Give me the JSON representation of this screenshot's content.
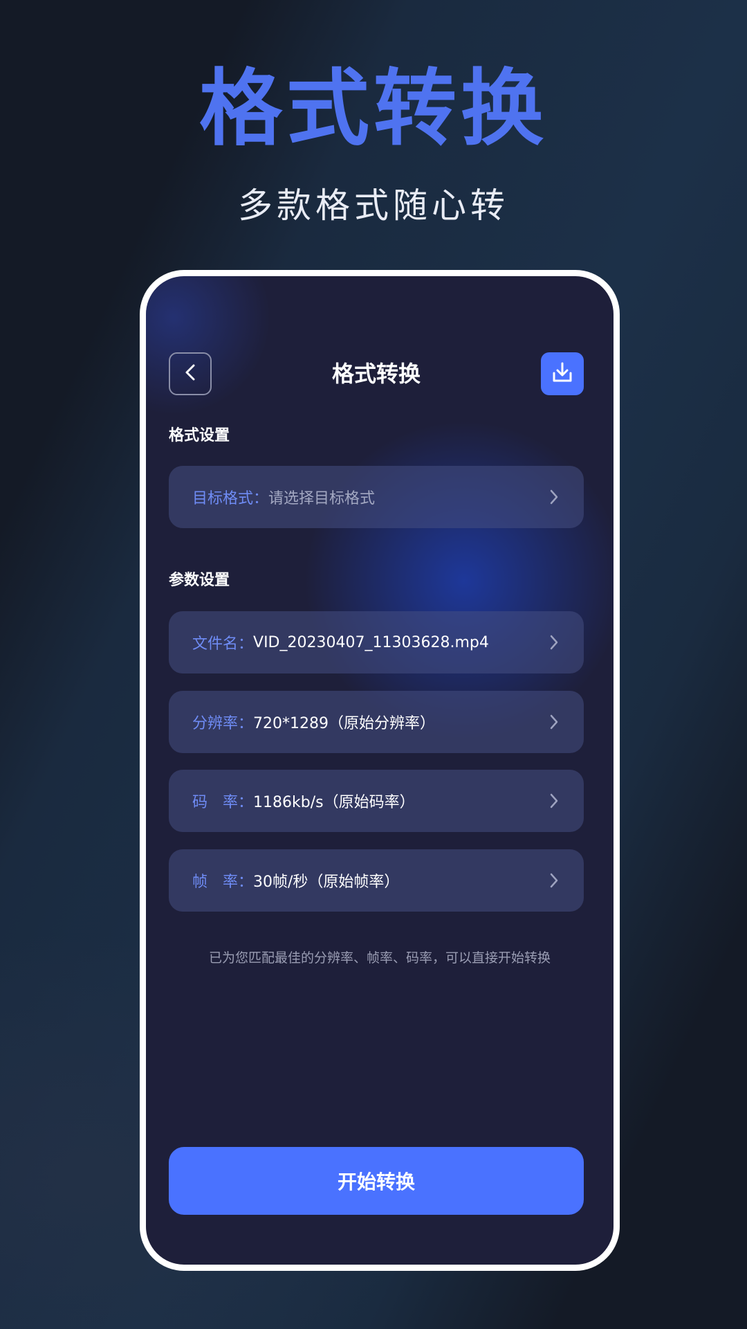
{
  "poster": {
    "title": "格式转换",
    "subtitle": "多款格式随心转"
  },
  "nav": {
    "title": "格式转换",
    "back_icon": "chevron-left-icon",
    "download_icon": "download-icon"
  },
  "format_section": {
    "label": "格式设置",
    "target": {
      "key": "目标格式：",
      "placeholder": "请选择目标格式"
    }
  },
  "params_section": {
    "label": "参数设置",
    "rows": [
      {
        "key": "文件名：",
        "value": "VID_20230407_11303628.mp4"
      },
      {
        "key": "分辨率：",
        "value": "720*1289（原始分辨率）"
      },
      {
        "key": "码　率：",
        "value": "1186kb/s（原始码率）"
      },
      {
        "key": "帧　率：",
        "value": "30帧/秒（原始帧率）"
      }
    ]
  },
  "hint": "已为您匹配最佳的分辨率、帧率、码率，可以直接开始转换",
  "start_button": "开始转换",
  "colors": {
    "accent": "#4a72ff",
    "title_blue": "#4f73f0",
    "key_blue": "#6f8cf5"
  }
}
